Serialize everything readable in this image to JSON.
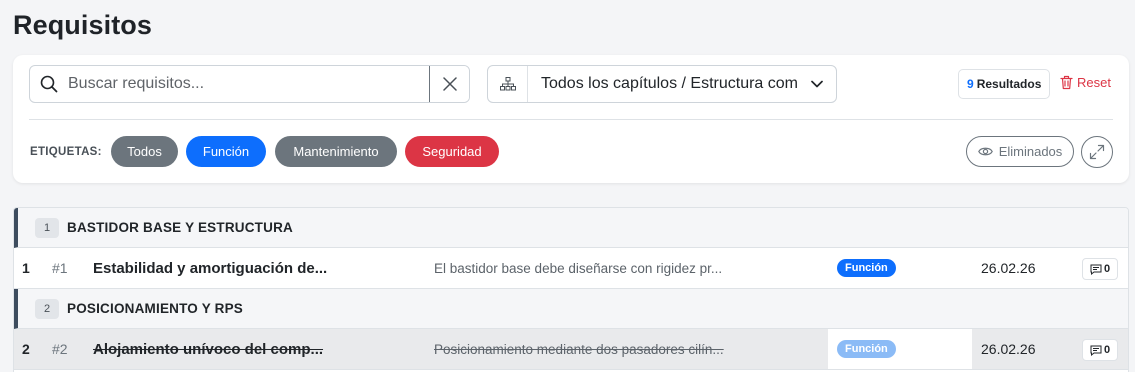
{
  "page": {
    "title": "Requisitos"
  },
  "filters": {
    "search": {
      "placeholder": "Buscar requisitos...",
      "value": ""
    },
    "chapter_select": {
      "selected": "Todos los capítulos / Estructura comp"
    },
    "results": {
      "count": "9",
      "label": "Resultados"
    },
    "reset_label": "Reset",
    "tags_label": "ETIQUETAS:",
    "tags": [
      {
        "label": "Todos",
        "color": "#6c757d"
      },
      {
        "label": "Función",
        "color": "#0d6efd"
      },
      {
        "label": "Mantenimiento",
        "color": "#6c757d"
      },
      {
        "label": "Seguridad",
        "color": "#dc3545"
      }
    ],
    "deleted_toggle_label": "Eliminados"
  },
  "table": {
    "chapters": [
      {
        "number": "1",
        "title": "BASTIDOR BASE Y ESTRUCTURA",
        "rows": [
          {
            "index": "1",
            "id": "#1",
            "title": "Estabilidad y amortiguación de...",
            "description": "El bastidor base debe diseñarse con rigidez pr...",
            "tag": "Función",
            "date": "26.02.26",
            "comments": "0",
            "deleted": false
          }
        ]
      },
      {
        "number": "2",
        "title": "POSICIONAMIENTO Y RPS",
        "rows": [
          {
            "index": "2",
            "id": "#2",
            "title": "Alojamiento unívoco del comp...",
            "description": "Posicionamiento mediante dos pasadores cilín...",
            "tag": "Función",
            "date": "26.02.26",
            "comments": "0",
            "deleted": true
          }
        ]
      }
    ]
  },
  "colors": {
    "primary": "#0d6efd",
    "danger": "#dc3545",
    "secondary": "#6c757d",
    "chapter_accent": "#3d4c5e"
  }
}
